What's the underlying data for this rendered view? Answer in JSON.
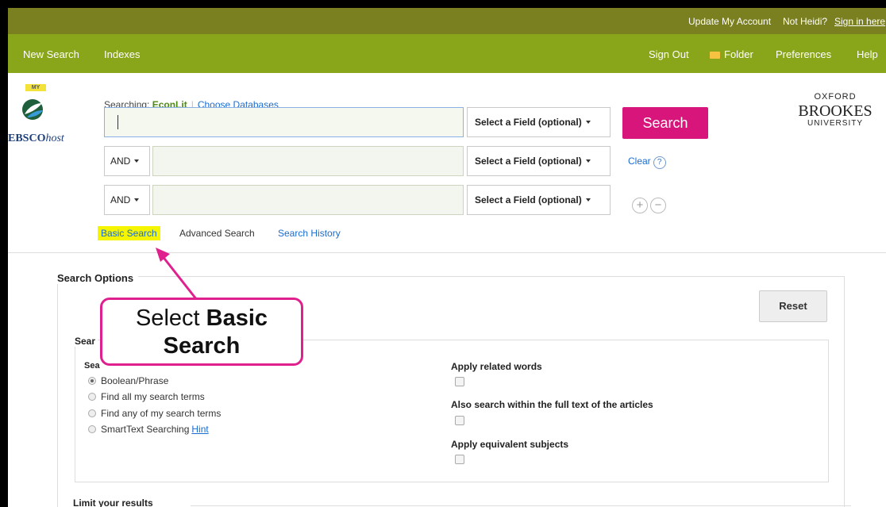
{
  "topbar": {
    "update_account": "Update My Account",
    "not_user": "Not Heidi?",
    "sign_in": "Sign in here"
  },
  "nav": {
    "new_search": "New Search",
    "indexes": "Indexes",
    "sign_out": "Sign Out",
    "folder": "Folder",
    "preferences": "Preferences",
    "help": "Help"
  },
  "logo": {
    "badge": "MY",
    "brand_bold": "EBSCO",
    "brand_italic": "host"
  },
  "search": {
    "searching_label": "Searching:",
    "database": "EconLit",
    "choose_databases": "Choose Databases",
    "rows": [
      {
        "field": "Select a Field (optional)",
        "value": ""
      },
      {
        "bool": "AND",
        "field": "Select a Field (optional)",
        "value": ""
      },
      {
        "bool": "AND",
        "field": "Select a Field (optional)",
        "value": ""
      }
    ],
    "search_button": "Search",
    "clear": "Clear",
    "help_glyph": "?",
    "add_glyph": "+",
    "remove_glyph": "−"
  },
  "institution": {
    "line1": "OXFORD",
    "line2": "BROOKES",
    "line3": "UNIVERSITY"
  },
  "tabs": {
    "basic": "Basic Search",
    "advanced": "Advanced Search",
    "history": "Search History"
  },
  "options": {
    "title": "Search Options",
    "reset": "Reset",
    "modes_label": "Sear",
    "modes_sublabel": "Sea",
    "modes": [
      {
        "label": "Boolean/Phrase",
        "checked": true
      },
      {
        "label": "Find all my search terms",
        "checked": false
      },
      {
        "label": "Find any of my search terms",
        "checked": false
      },
      {
        "label": "SmartText Searching",
        "checked": false
      }
    ],
    "hint": "Hint",
    "apply_related": "Apply related words",
    "full_text": "Also search within the full text of the articles",
    "equivalent_subjects": "Apply equivalent subjects",
    "limit_title": "Limit your results"
  },
  "callout": {
    "line1_plain": "Select ",
    "line1_bold": "Basic",
    "line2_bold": "Search",
    "color": "#e0208d"
  },
  "colors": {
    "topbar": "#7a7f1f",
    "navbar": "#89a51a",
    "search_button": "#d8157a",
    "highlight": "#f5f500"
  }
}
